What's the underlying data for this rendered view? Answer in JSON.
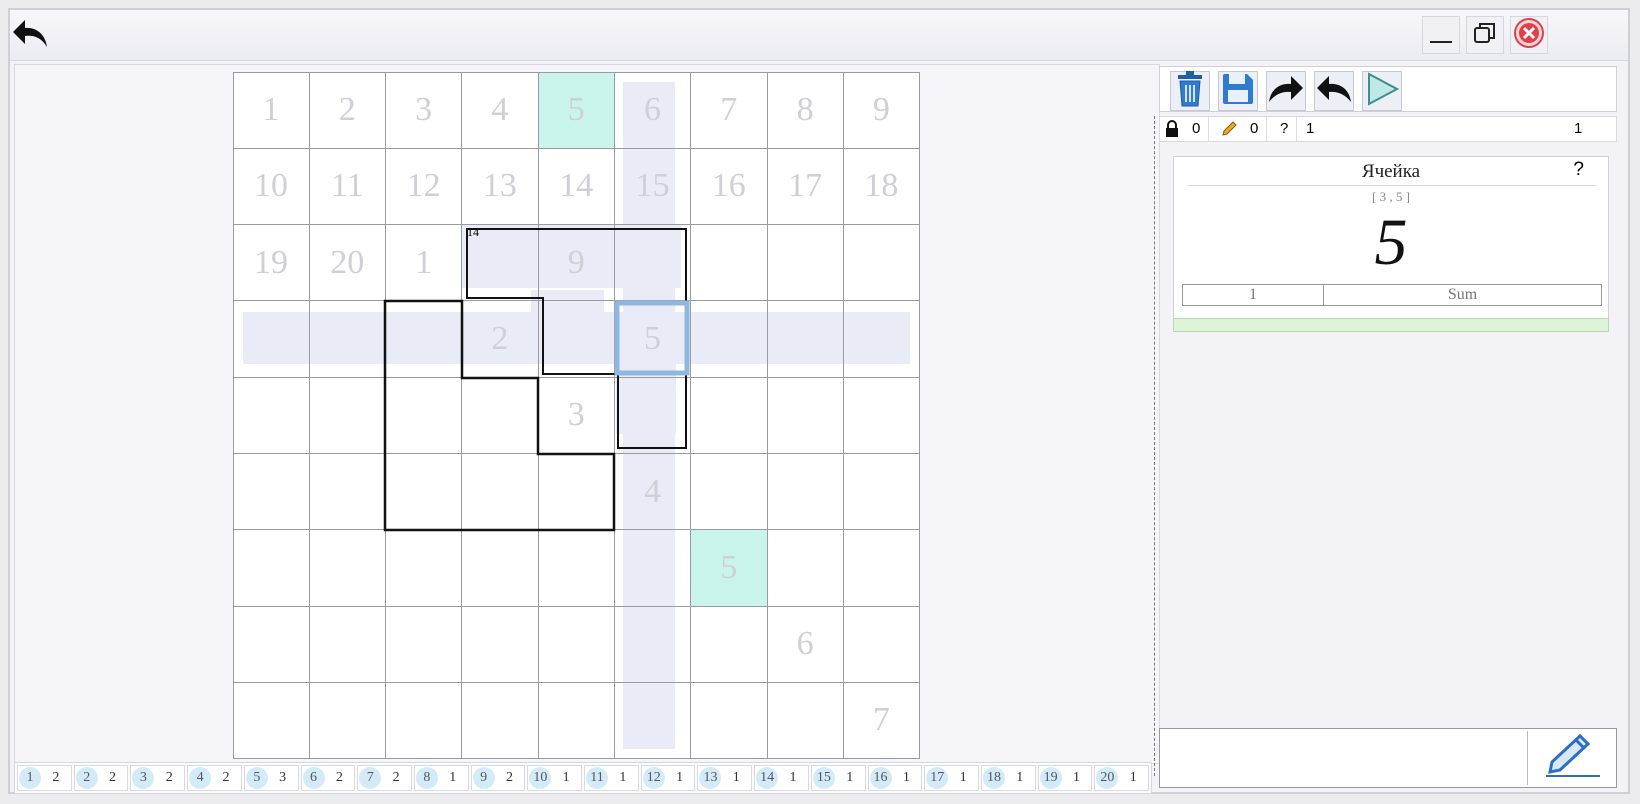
{
  "window": {
    "back_icon": "back-arrow-icon",
    "minimize_icon": "minimize-icon",
    "restore_icon": "restore-icon",
    "close_icon": "close-icon",
    "close_color": "#e0404a"
  },
  "board": {
    "accent_highlight": "#e9ebf6",
    "match_color": "#c9f4ec",
    "selected_color": "#8fb8e0",
    "cage_sum": "14",
    "cells": [
      {
        "r": 0,
        "c": 0,
        "v": "1"
      },
      {
        "r": 0,
        "c": 1,
        "v": "2"
      },
      {
        "r": 0,
        "c": 2,
        "v": "3"
      },
      {
        "r": 0,
        "c": 3,
        "v": "4"
      },
      {
        "r": 0,
        "c": 4,
        "v": "5",
        "match": true
      },
      {
        "r": 0,
        "c": 5,
        "v": "6"
      },
      {
        "r": 0,
        "c": 6,
        "v": "7"
      },
      {
        "r": 0,
        "c": 7,
        "v": "8"
      },
      {
        "r": 0,
        "c": 8,
        "v": "9"
      },
      {
        "r": 1,
        "c": 0,
        "v": "10"
      },
      {
        "r": 1,
        "c": 1,
        "v": "11"
      },
      {
        "r": 1,
        "c": 2,
        "v": "12"
      },
      {
        "r": 1,
        "c": 3,
        "v": "13"
      },
      {
        "r": 1,
        "c": 4,
        "v": "14"
      },
      {
        "r": 1,
        "c": 5,
        "v": "15"
      },
      {
        "r": 1,
        "c": 6,
        "v": "16"
      },
      {
        "r": 1,
        "c": 7,
        "v": "17"
      },
      {
        "r": 1,
        "c": 8,
        "v": "18"
      },
      {
        "r": 2,
        "c": 0,
        "v": "19"
      },
      {
        "r": 2,
        "c": 1,
        "v": "20"
      },
      {
        "r": 2,
        "c": 2,
        "v": "1"
      },
      {
        "r": 2,
        "c": 4,
        "v": "9"
      },
      {
        "r": 3,
        "c": 3,
        "v": "2"
      },
      {
        "r": 3,
        "c": 5,
        "v": "5",
        "selected": true
      },
      {
        "r": 4,
        "c": 4,
        "v": "3"
      },
      {
        "r": 5,
        "c": 5,
        "v": "4"
      },
      {
        "r": 6,
        "c": 6,
        "v": "5",
        "match": true
      },
      {
        "r": 7,
        "c": 7,
        "v": "6"
      },
      {
        "r": 8,
        "c": 8,
        "v": "7"
      }
    ]
  },
  "counts": [
    {
      "n": "1",
      "c": "2"
    },
    {
      "n": "2",
      "c": "2"
    },
    {
      "n": "3",
      "c": "2"
    },
    {
      "n": "4",
      "c": "2"
    },
    {
      "n": "5",
      "c": "3"
    },
    {
      "n": "6",
      "c": "2"
    },
    {
      "n": "7",
      "c": "2"
    },
    {
      "n": "8",
      "c": "1"
    },
    {
      "n": "9",
      "c": "2"
    },
    {
      "n": "10",
      "c": "1"
    },
    {
      "n": "11",
      "c": "1"
    },
    {
      "n": "12",
      "c": "1"
    },
    {
      "n": "13",
      "c": "1"
    },
    {
      "n": "14",
      "c": "1"
    },
    {
      "n": "15",
      "c": "1"
    },
    {
      "n": "16",
      "c": "1"
    },
    {
      "n": "17",
      "c": "1"
    },
    {
      "n": "18",
      "c": "1"
    },
    {
      "n": "19",
      "c": "1"
    },
    {
      "n": "20",
      "c": "1"
    }
  ],
  "toolbar": {
    "icons": [
      "trash-icon",
      "save-icon",
      "redo-icon",
      "undo-icon",
      "play-icon"
    ]
  },
  "status": {
    "locked": "0",
    "pencil": "0",
    "question": "?",
    "value_left": "1",
    "value_right": "1"
  },
  "info": {
    "title": "Ячейка",
    "help": "?",
    "coords": "[ 3 , 5 ]",
    "value": "5",
    "table_col1": "1",
    "table_col2": "Sum"
  },
  "note": {
    "pencil_icon": "pencil-icon"
  }
}
